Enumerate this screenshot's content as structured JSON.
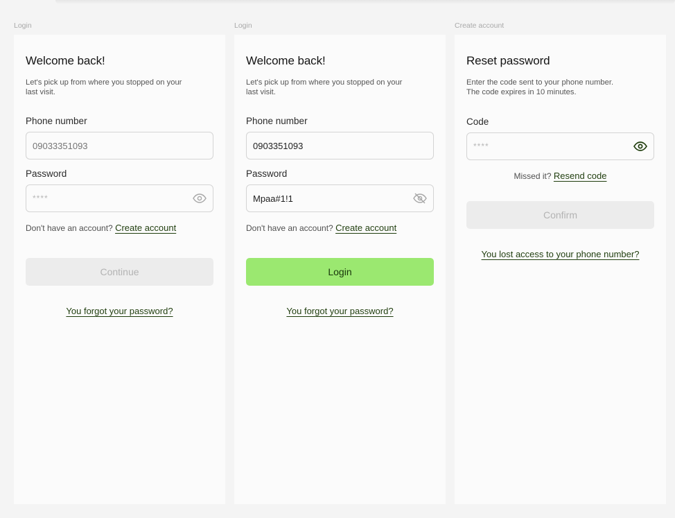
{
  "screens": [
    {
      "frame_label": "Login",
      "title": "Welcome back!",
      "subtitle_lines": [
        "Let's pick up from where you stopped on your",
        "last visit."
      ],
      "phone_label": "Phone number",
      "phone_placeholder": "09033351093",
      "phone_value": "",
      "password_label": "Password",
      "password_display": "****",
      "password_icon": "eye-icon",
      "no_account_text": "Don't have an account?",
      "create_account_link": "Create account",
      "primary_button": "Continue",
      "primary_button_state": "disabled",
      "forgot_link": "You forgot your password?"
    },
    {
      "frame_label": "Login",
      "title": "Welcome back!",
      "subtitle_lines": [
        "Let's pick up from where you stopped on your",
        "last visit."
      ],
      "phone_label": "Phone number",
      "phone_value": "0903351093",
      "password_label": "Password",
      "password_display": "Mpaa#1!1",
      "password_icon": "eye-off-icon",
      "no_account_text": "Don't have an account?",
      "create_account_link": "Create account",
      "primary_button": "Login",
      "primary_button_state": "active",
      "forgot_link": "You forgot your password?"
    },
    {
      "frame_label": "Create account",
      "title": "Reset password",
      "subtitle_lines": [
        "Enter the code sent to your phone number.",
        "The code expires in 10 minutes."
      ],
      "code_label": "Code",
      "code_display": "****",
      "code_icon": "eye-icon",
      "missed_text": "Missed it?",
      "resend_link": "Resend code",
      "primary_button": "Confirm",
      "primary_button_state": "disabled",
      "lost_access_link": "You lost access to your phone number?"
    }
  ],
  "colors": {
    "background": "#f4f4f4",
    "card": "#fbfbfb",
    "accent_green": "#9be870",
    "link_dark_green": "#1f3d0d",
    "disabled_button": "#ececec"
  }
}
